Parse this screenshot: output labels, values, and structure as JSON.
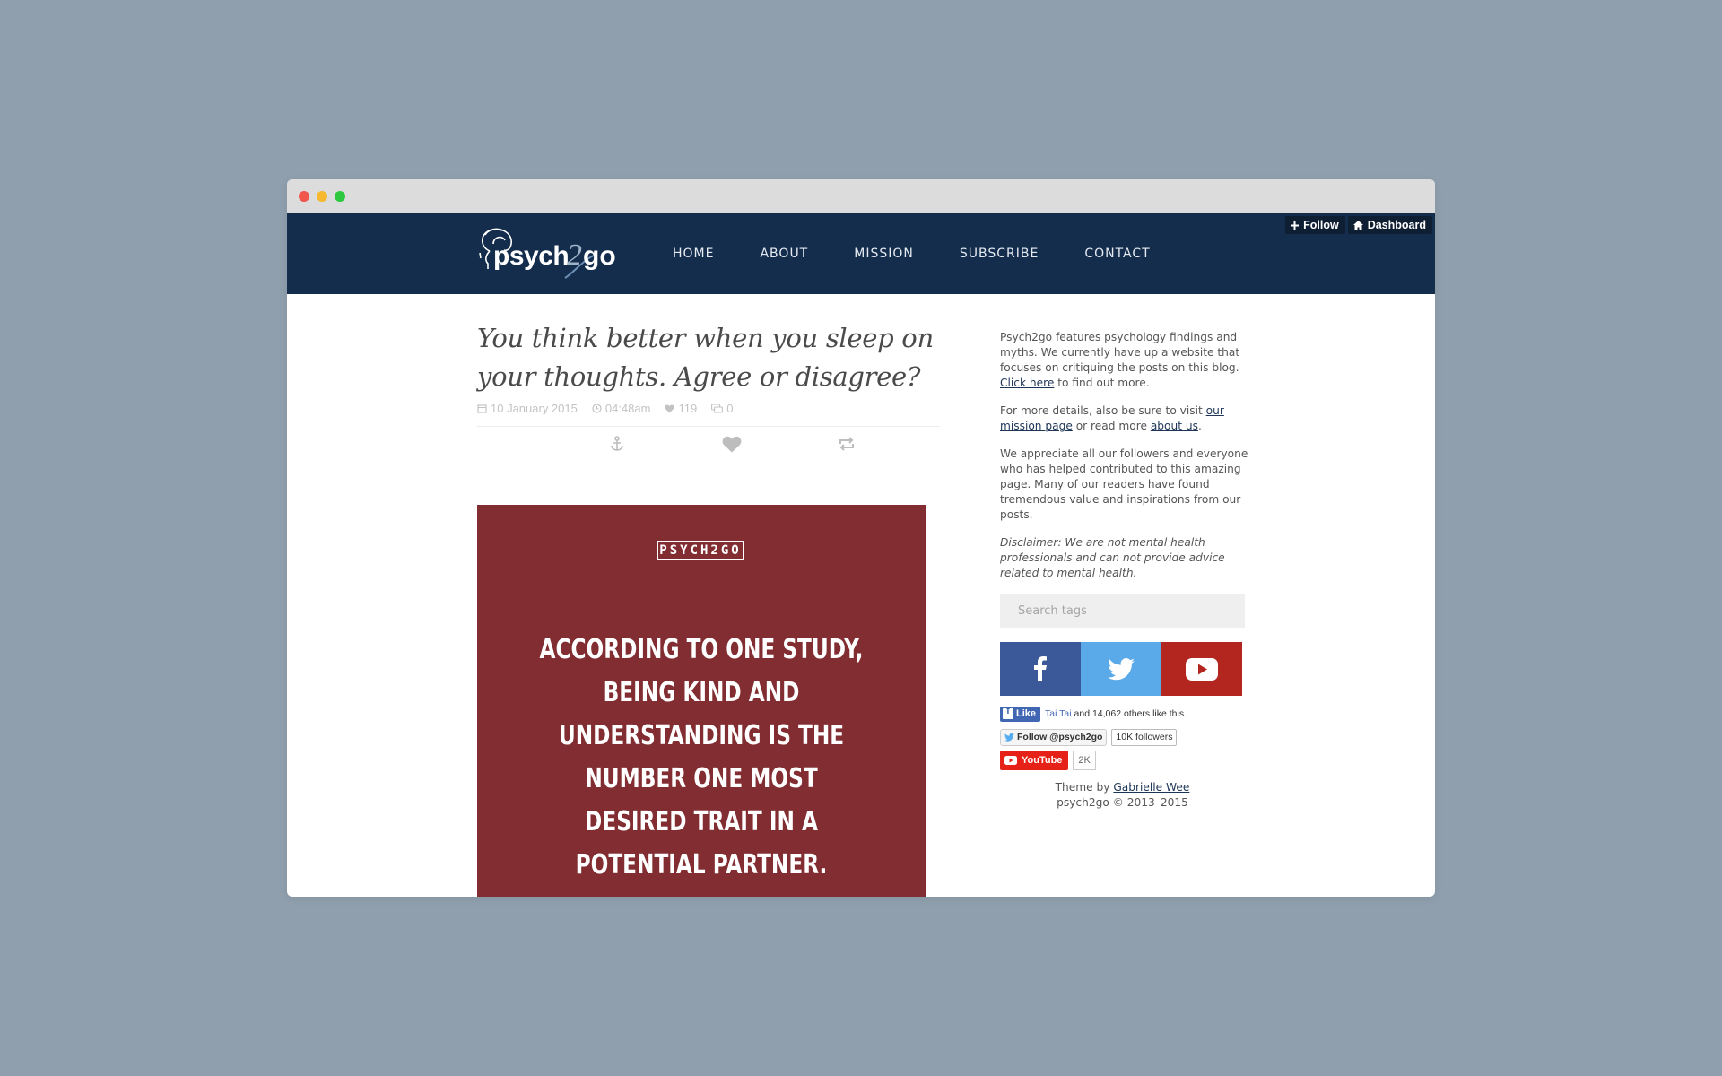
{
  "topbar": {
    "follow_label": "Follow",
    "dashboard_label": "Dashboard"
  },
  "nav": {
    "items": [
      {
        "label": "HOME"
      },
      {
        "label": "ABOUT"
      },
      {
        "label": "MISSION"
      },
      {
        "label": "SUBSCRIBE"
      },
      {
        "label": "CONTACT"
      }
    ]
  },
  "logo": {
    "text": "psych2go",
    "icon": "head-silhouette-logo"
  },
  "post": {
    "title": "You think better when you sleep on your thoughts. Agree or disagree?",
    "date": "10 January 2015",
    "time": "04:48am",
    "likes": "119",
    "comments": "0",
    "icons": [
      "calendar-icon",
      "clock-icon",
      "heart-icon",
      "comment-icon",
      "anchor-icon",
      "like-icon",
      "reblog-icon"
    ],
    "image": {
      "badge": "PSYCH2GO",
      "quote": "According to one study, being kind and understanding is the number one most desired trait in a potential partner.",
      "background": "#812d31"
    }
  },
  "sidebar": {
    "about_p1_text": "Psych2go features psychology findings and myths. We currently have up a website that focuses on critiquing the posts on this blog.",
    "about_p1_link": "Click here",
    "about_p1_tail": "to find out more.",
    "about_p2_text": "For more details, also be sure to visit",
    "about_p2_link1": "our mission page",
    "about_p2_mid": "or read more",
    "about_p2_link2": "about us",
    "about_p3": "We appreciate all our followers and everyone who has helped contributed to this amazing page. Many of our readers have found tremendous value and inspirations from our posts.",
    "disclaimer": "Disclaimer: We are not mental health professionals and can not provide advice related to mental health.",
    "search_placeholder": "Search tags",
    "social": [
      {
        "name": "facebook-icon",
        "color": "#3b5998"
      },
      {
        "name": "twitter-icon",
        "color": "#5aa9e8"
      },
      {
        "name": "youtube-icon",
        "color": "#b2261f"
      }
    ],
    "fb_like_label": "Like",
    "fb_name": "Tai Tai",
    "fb_rest": "and 14,062 others like this.",
    "tw_follow_label": "Follow @psych2go",
    "tw_followers": "10K followers",
    "yt_label": "YouTube",
    "yt_count": "2K",
    "theme_by": "Theme by",
    "theme_author": "Gabrielle Wee",
    "copyright": "psych2go © 2013–2015"
  }
}
